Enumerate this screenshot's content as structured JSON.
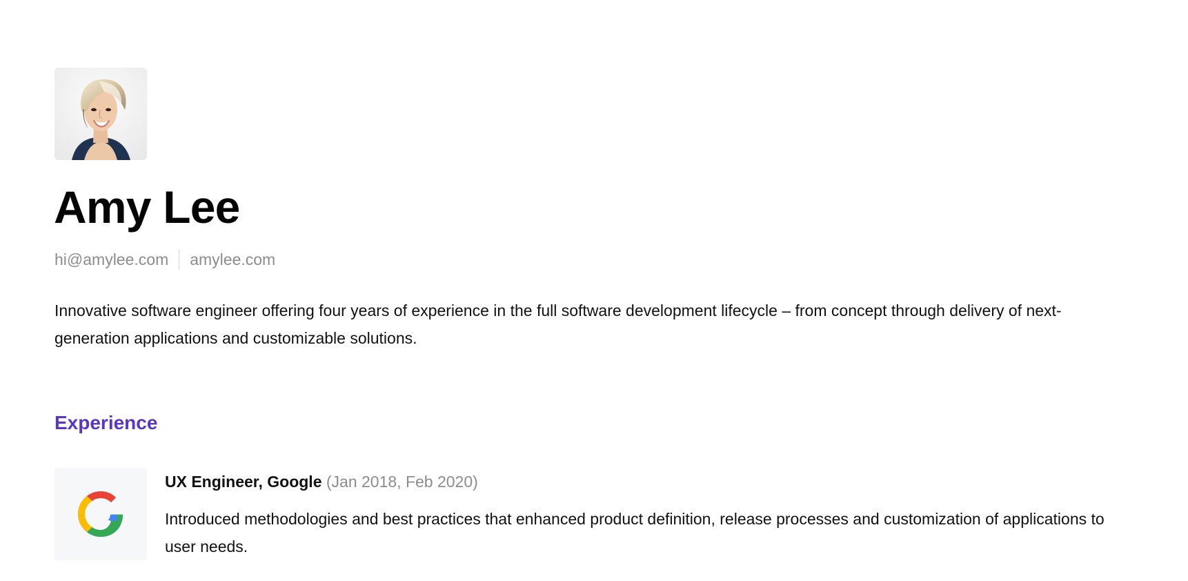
{
  "profile": {
    "name": "Amy Lee",
    "avatar_alt": "Amy Lee",
    "email": "hi@amylee.com",
    "website": "amylee.com",
    "summary": "Innovative software engineer offering four years of experience in the full software development lifecycle – from concept through delivery of next-generation applications and customizable solutions."
  },
  "experience": {
    "section_title": "Experience",
    "items": [
      {
        "title": "UX Engineer, Google",
        "dates": "(Jan 2018, Feb 2020)",
        "description": "Introduced methodologies and best practices that enhanced product definition, release processes and customization of applications to user needs.",
        "logo_icon": "google-logo-icon"
      }
    ]
  },
  "colors": {
    "accent": "#5a35c6",
    "muted_text": "#8c8c8c",
    "body_text": "#111111",
    "logo_tile": "#f6f7f9",
    "google_blue": "#4285f4",
    "google_red": "#ea4335",
    "google_yellow": "#fbbc05",
    "google_green": "#34a853"
  }
}
